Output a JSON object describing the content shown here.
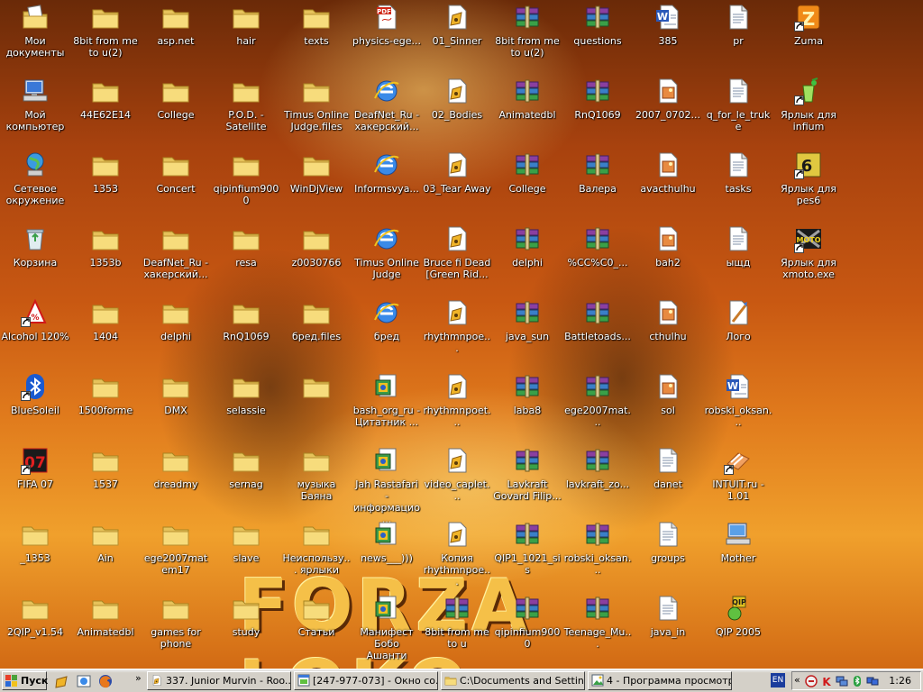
{
  "desktop": {
    "wallpaper_text": "FORZA LOKO",
    "icons": [
      {
        "label": "Мои документы",
        "icon": "my-documents-icon",
        "shortcut": false
      },
      {
        "label": "Мой компьютер",
        "icon": "my-computer-icon",
        "shortcut": false
      },
      {
        "label": "Сетевое окружение",
        "icon": "network-icon",
        "shortcut": false
      },
      {
        "label": "Корзина",
        "icon": "recycle-bin-icon",
        "shortcut": false
      },
      {
        "label": "Alcohol 120%",
        "icon": "alcohol-icon",
        "shortcut": true
      },
      {
        "label": "BlueSoleil",
        "icon": "bluetooth-icon",
        "shortcut": true
      },
      {
        "label": "FIFA 07",
        "icon": "fifa-icon",
        "shortcut": true
      },
      {
        "label": "_1353",
        "icon": "folder-icon",
        "shortcut": false
      },
      {
        "label": "2QIP_v1.54",
        "icon": "folder-icon",
        "shortcut": false
      },
      {
        "label": "8bit from me to u(2)",
        "icon": "folder-icon",
        "shortcut": false
      },
      {
        "label": "44E62E14",
        "icon": "folder-icon",
        "shortcut": false
      },
      {
        "label": "1353",
        "icon": "folder-icon",
        "shortcut": false
      },
      {
        "label": "1353b",
        "icon": "folder-icon",
        "shortcut": false
      },
      {
        "label": "1404",
        "icon": "folder-icon",
        "shortcut": false
      },
      {
        "label": "1500forme",
        "icon": "folder-icon",
        "shortcut": false
      },
      {
        "label": "1537",
        "icon": "folder-icon",
        "shortcut": false
      },
      {
        "label": "Ain",
        "icon": "folder-icon",
        "shortcut": false
      },
      {
        "label": "Animatedbl",
        "icon": "folder-icon",
        "shortcut": false
      },
      {
        "label": "asp.net",
        "icon": "folder-icon",
        "shortcut": false
      },
      {
        "label": "College",
        "icon": "folder-icon",
        "shortcut": false
      },
      {
        "label": "Concert",
        "icon": "folder-icon",
        "shortcut": false
      },
      {
        "label": "DeafNet_Ru - хакерский...",
        "icon": "folder-icon",
        "shortcut": false
      },
      {
        "label": "delphi",
        "icon": "folder-icon",
        "shortcut": false
      },
      {
        "label": "DMX",
        "icon": "folder-icon",
        "shortcut": false
      },
      {
        "label": "dreadmy",
        "icon": "folder-icon",
        "shortcut": false
      },
      {
        "label": "ege2007matem17",
        "icon": "folder-icon",
        "shortcut": false
      },
      {
        "label": "games for phone",
        "icon": "folder-icon",
        "shortcut": false
      },
      {
        "label": "hair",
        "icon": "folder-icon",
        "shortcut": false
      },
      {
        "label": "P.O.D. - Satellite",
        "icon": "folder-icon",
        "shortcut": false
      },
      {
        "label": "qipinfium9000",
        "icon": "folder-icon",
        "shortcut": false
      },
      {
        "label": "resa",
        "icon": "folder-icon",
        "shortcut": false
      },
      {
        "label": "RnQ1069",
        "icon": "folder-icon",
        "shortcut": false
      },
      {
        "label": "selassie",
        "icon": "folder-icon",
        "shortcut": false
      },
      {
        "label": "sernag",
        "icon": "folder-icon",
        "shortcut": false
      },
      {
        "label": "slave",
        "icon": "folder-icon",
        "shortcut": false
      },
      {
        "label": "study",
        "icon": "folder-icon",
        "shortcut": false
      },
      {
        "label": "texts",
        "icon": "folder-icon",
        "shortcut": false
      },
      {
        "label": "Timus Online Judge.files",
        "icon": "folder-icon",
        "shortcut": false
      },
      {
        "label": "WinDjView",
        "icon": "folder-icon",
        "shortcut": false
      },
      {
        "label": "z0030766",
        "icon": "folder-icon",
        "shortcut": false
      },
      {
        "label": "бред.files",
        "icon": "folder-icon",
        "shortcut": false
      },
      {
        "label": "",
        "icon": "folder-icon",
        "shortcut": false
      },
      {
        "label": "музыка Баяна",
        "icon": "folder-icon",
        "shortcut": false
      },
      {
        "label": "Неиспользу... ярлыки",
        "icon": "folder-icon",
        "shortcut": false
      },
      {
        "label": "Статьи",
        "icon": "folder-icon",
        "shortcut": false
      },
      {
        "label": "physics-ege...",
        "icon": "pdf-icon",
        "shortcut": false
      },
      {
        "label": "DeafNet_Ru - хакерский...",
        "icon": "ie-icon",
        "shortcut": false
      },
      {
        "label": "Informsvya...",
        "icon": "ie-icon",
        "shortcut": false
      },
      {
        "label": "Timus Online Judge",
        "icon": "ie-icon",
        "shortcut": false
      },
      {
        "label": "бред",
        "icon": "ie-icon",
        "shortcut": false
      },
      {
        "label": "bash_org_ru - Цитатник ...",
        "icon": "html-page-icon",
        "shortcut": false
      },
      {
        "label": "Jah Rastafari - информацио...",
        "icon": "html-page-icon",
        "shortcut": false
      },
      {
        "label": "news___)))",
        "icon": "html-page-icon",
        "shortcut": false
      },
      {
        "label": "Манифест Бобо Ашанти",
        "icon": "html-page-icon",
        "shortcut": false
      },
      {
        "label": "01_Sinner",
        "icon": "media-file-icon",
        "shortcut": false
      },
      {
        "label": "02_Bodies",
        "icon": "media-file-icon",
        "shortcut": false
      },
      {
        "label": "03_Tear Away",
        "icon": "media-file-icon",
        "shortcut": false
      },
      {
        "label": "Bruce fi Dead [Green Rid...",
        "icon": "media-file-icon",
        "shortcut": false
      },
      {
        "label": "rhythmnpoe...",
        "icon": "media-file-icon",
        "shortcut": false
      },
      {
        "label": "rhythmnpoet...",
        "icon": "media-file-icon",
        "shortcut": false
      },
      {
        "label": "video_caplet...",
        "icon": "media-file-icon",
        "shortcut": false
      },
      {
        "label": "Копия rhythmnpoe...",
        "icon": "media-file-icon",
        "shortcut": false
      },
      {
        "label": "8bit from me to u",
        "icon": "winrar-icon",
        "shortcut": false
      },
      {
        "label": "8bit from me to u(2)",
        "icon": "winrar-icon",
        "shortcut": false
      },
      {
        "label": "Animatedbl",
        "icon": "winrar-icon",
        "shortcut": false
      },
      {
        "label": "College",
        "icon": "winrar-icon",
        "shortcut": false
      },
      {
        "label": "delphi",
        "icon": "winrar-icon",
        "shortcut": false
      },
      {
        "label": "java_sun",
        "icon": "winrar-icon",
        "shortcut": false
      },
      {
        "label": "laba8",
        "icon": "winrar-icon",
        "shortcut": false
      },
      {
        "label": "Lavkraft Govard Filip...",
        "icon": "winrar-icon",
        "shortcut": false
      },
      {
        "label": "QIP1_1021_sis",
        "icon": "winrar-icon",
        "shortcut": false
      },
      {
        "label": "qipinfium9000",
        "icon": "winrar-icon",
        "shortcut": false
      },
      {
        "label": "questions",
        "icon": "winrar-icon",
        "shortcut": false
      },
      {
        "label": "RnQ1069",
        "icon": "winrar-icon",
        "shortcut": false
      },
      {
        "label": "Валера",
        "icon": "winrar-icon",
        "shortcut": false
      },
      {
        "label": "%CC%C0_...",
        "icon": "winrar-icon",
        "shortcut": false
      },
      {
        "label": "Battletoads...",
        "icon": "winrar-icon",
        "shortcut": false
      },
      {
        "label": "ege2007mat...",
        "icon": "winrar-icon",
        "shortcut": false
      },
      {
        "label": "lavkraft_zo...",
        "icon": "winrar-icon",
        "shortcut": false
      },
      {
        "label": "robski_oksan...",
        "icon": "winrar-icon",
        "shortcut": false
      },
      {
        "label": "Teenage_Mu...",
        "icon": "winrar-icon",
        "shortcut": false
      },
      {
        "label": "385",
        "icon": "word-doc-icon",
        "shortcut": false
      },
      {
        "label": "2007_0702...",
        "icon": "image-file-icon",
        "shortcut": false
      },
      {
        "label": "avacthulhu",
        "icon": "image-file-icon",
        "shortcut": false
      },
      {
        "label": "bah2",
        "icon": "image-file-icon",
        "shortcut": false
      },
      {
        "label": "cthulhu",
        "icon": "image-file-icon",
        "shortcut": false
      },
      {
        "label": "sol",
        "icon": "image-file-icon",
        "shortcut": false
      },
      {
        "label": "danet",
        "icon": "text-file-icon",
        "shortcut": false
      },
      {
        "label": "groups",
        "icon": "text-file-icon",
        "shortcut": false
      },
      {
        "label": "java_in",
        "icon": "text-file-icon",
        "shortcut": false
      },
      {
        "label": "pr",
        "icon": "text-file-icon",
        "shortcut": false
      },
      {
        "label": "q_for_le_truke",
        "icon": "text-file-icon",
        "shortcut": false
      },
      {
        "label": "tasks",
        "icon": "text-file-icon",
        "shortcut": false
      },
      {
        "label": "ыщд",
        "icon": "text-file-icon",
        "shortcut": false
      },
      {
        "label": "Лого",
        "icon": "paint-image-icon",
        "shortcut": false
      },
      {
        "label": "robski_oksan...",
        "icon": "word-doc-icon",
        "shortcut": false
      },
      {
        "label": "INTUIT.ru - 1.01",
        "icon": "intuit-icon",
        "shortcut": true
      },
      {
        "label": "Mother",
        "icon": "computer-doc-icon",
        "shortcut": false
      },
      {
        "label": "QIP 2005",
        "icon": "qip-icon",
        "shortcut": false
      },
      {
        "label": "Zuma",
        "icon": "zuma-icon",
        "shortcut": true
      },
      {
        "label": "Ярлык для infium",
        "icon": "infium-icon",
        "shortcut": true
      },
      {
        "label": "Ярлык для pes6",
        "icon": "pes6-icon",
        "shortcut": true
      },
      {
        "label": "Ярлык для xmoto.exe",
        "icon": "xmoto-icon",
        "shortcut": true
      }
    ]
  },
  "taskbar": {
    "start_label": "Пуск",
    "quick_launch": [
      "media-player-icon",
      "ie-quick-icon",
      "firefox-icon"
    ],
    "more": "»",
    "tasks": [
      {
        "label": "337. Junior Murvin - Roo...",
        "icon": "media-file-icon",
        "active": false
      },
      {
        "label": "[247-977-073] - Окно со...",
        "icon": "chat-window-icon",
        "active": false
      },
      {
        "label": "C:\\Documents and Settin...",
        "icon": "folder-icon",
        "active": false
      },
      {
        "label": "4 - Программа просмотр...",
        "icon": "image-viewer-icon",
        "active": false
      }
    ],
    "language": "EN",
    "tray_chevron": "«",
    "tray_icons": [
      "antivirus-icon",
      "kaspersky-icon",
      "network-status-icon",
      "bluetooth-tray-icon",
      "network-connection-icon"
    ],
    "clock": "1:26"
  }
}
